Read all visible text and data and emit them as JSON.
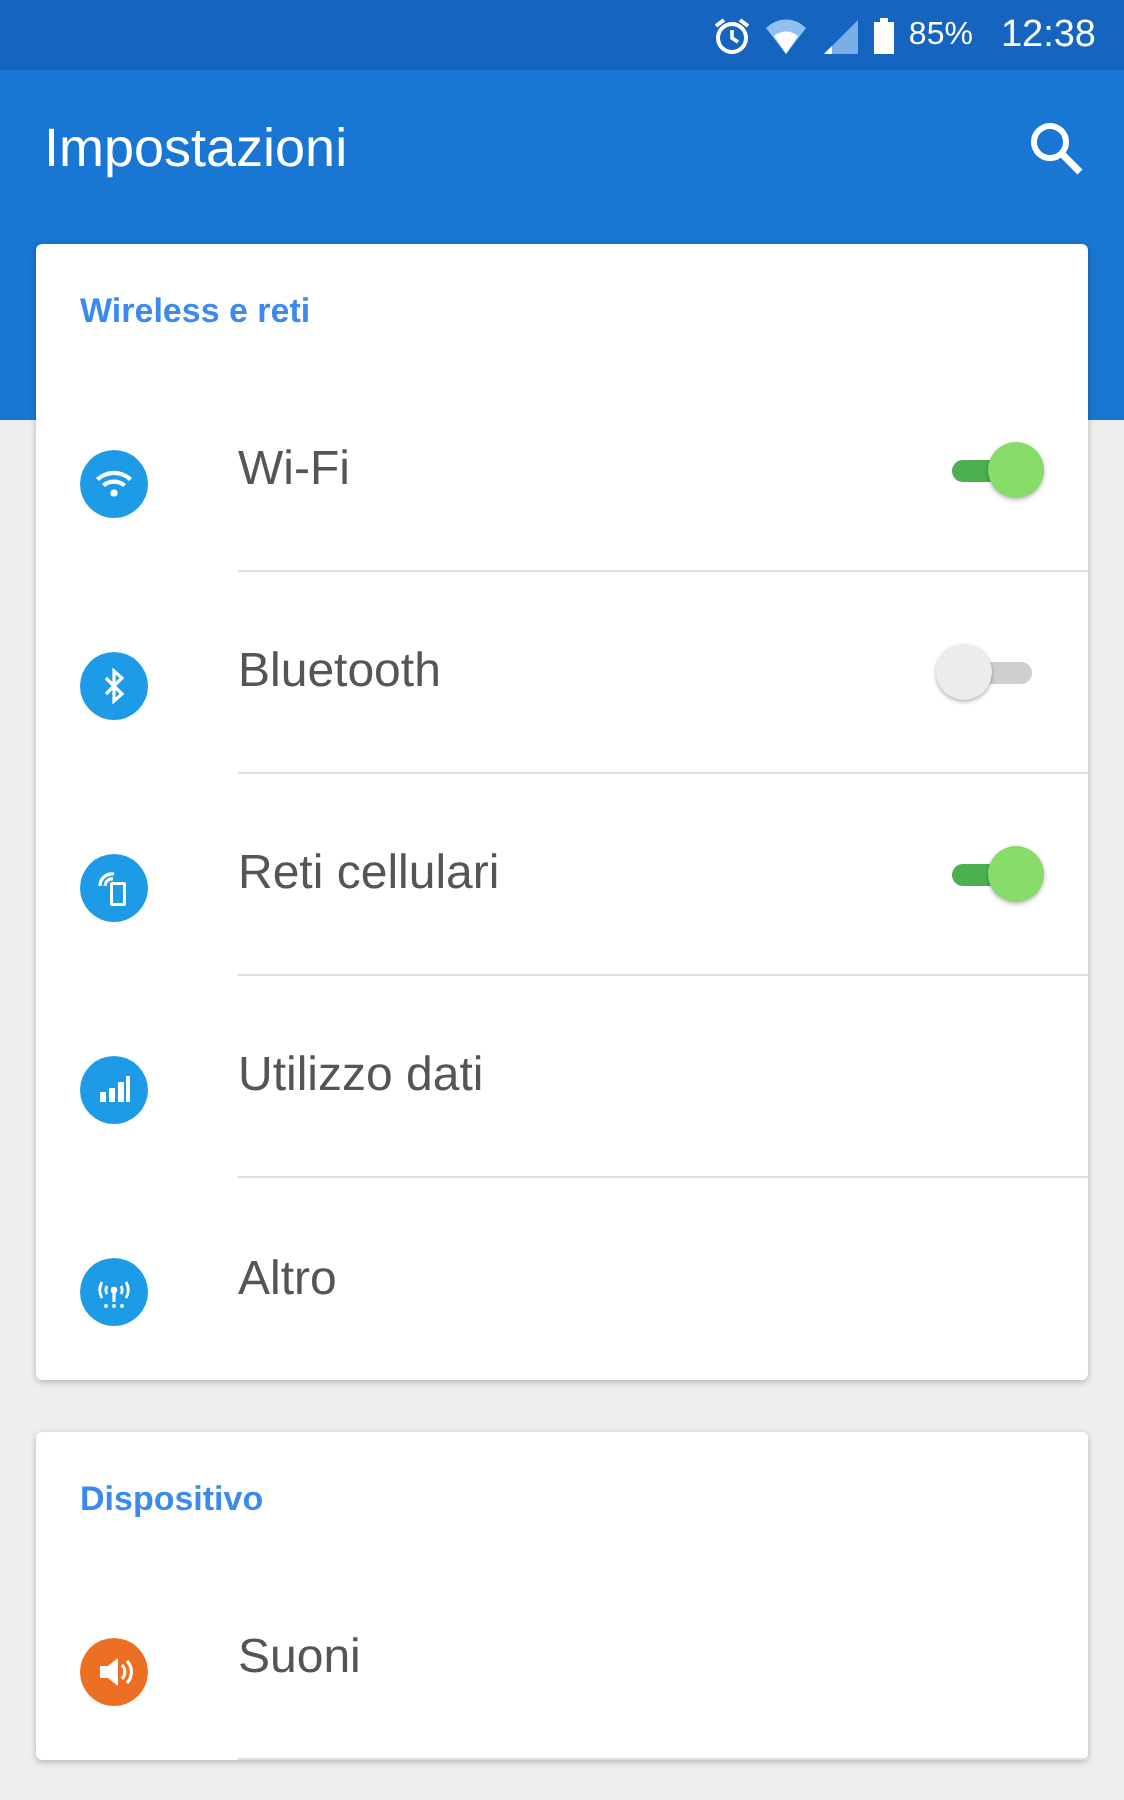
{
  "status_bar": {
    "battery": "85%",
    "time": "12:38"
  },
  "app_bar": {
    "title": "Impostazioni"
  },
  "sections": [
    {
      "title": "Wireless e reti",
      "items": [
        {
          "label": "Wi-Fi",
          "kind": "toggle",
          "on": true,
          "color": "#1e9be6"
        },
        {
          "label": "Bluetooth",
          "kind": "toggle",
          "on": false,
          "color": "#1e9be6"
        },
        {
          "label": "Reti cellulari",
          "kind": "toggle",
          "on": true,
          "color": "#1e9be6"
        },
        {
          "label": "Utilizzo dati",
          "kind": "plain",
          "color": "#1e9be6"
        },
        {
          "label": "Altro",
          "kind": "plain",
          "color": "#1e9be6"
        }
      ]
    },
    {
      "title": "Dispositivo",
      "items": [
        {
          "label": "Suoni",
          "kind": "plain",
          "color": "#ec7024"
        }
      ]
    }
  ]
}
